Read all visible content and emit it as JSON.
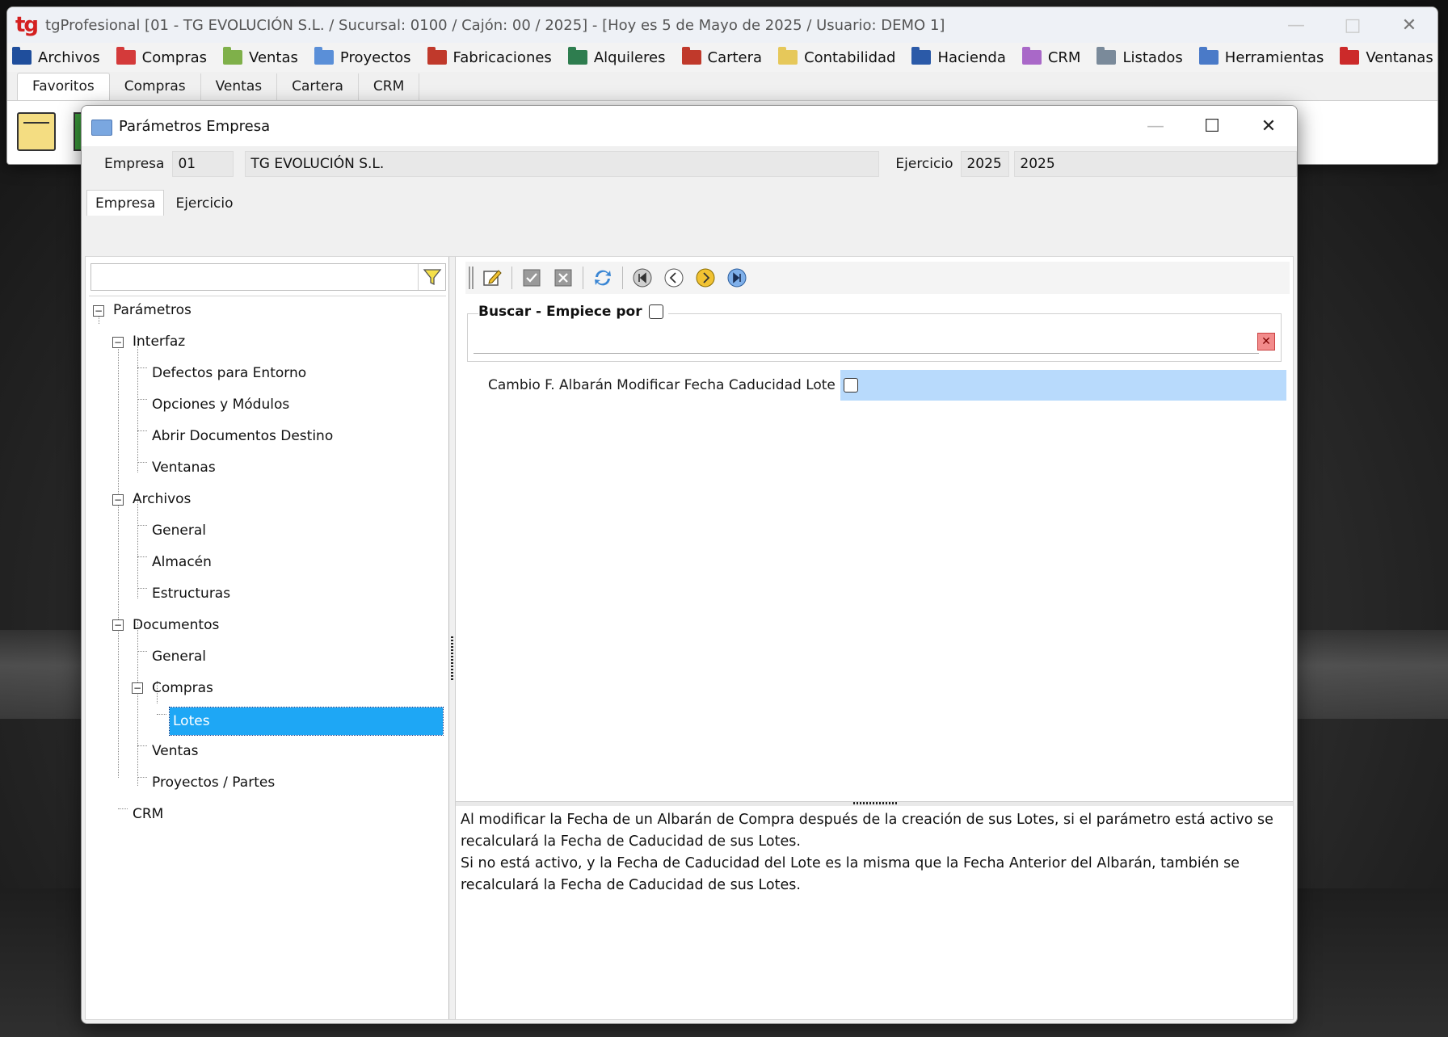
{
  "main_window": {
    "logo": "tg",
    "title": "tgProfesional [01 - TG EVOLUCIÓN S.L. / Sucursal: 0100 / Cajón: 00 / 2025] - [Hoy es 5 de Mayo de 2025 / Usuario: DEMO 1]"
  },
  "menu": [
    {
      "label": "Archivos",
      "color": "#1f4e9c"
    },
    {
      "label": "Compras",
      "color": "#d43a3a"
    },
    {
      "label": "Ventas",
      "color": "#7fb04a"
    },
    {
      "label": "Proyectos",
      "color": "#5a8fd8"
    },
    {
      "label": "Fabricaciones",
      "color": "#c0392b"
    },
    {
      "label": "Alquileres",
      "color": "#2e7d4f"
    },
    {
      "label": "Cartera",
      "color": "#c0392b"
    },
    {
      "label": "Contabilidad",
      "color": "#e6c85a"
    },
    {
      "label": "Hacienda",
      "color": "#2b5aa8"
    },
    {
      "label": "CRM",
      "color": "#a968c8"
    },
    {
      "label": "Listados",
      "color": "#7a8a9a"
    },
    {
      "label": "Herramientas",
      "color": "#4a7ac8"
    },
    {
      "label": "Ventanas",
      "color": "#cc2a2a"
    }
  ],
  "ribbon_tabs": [
    "Favoritos",
    "Compras",
    "Ventas",
    "Cartera",
    "CRM"
  ],
  "dialog": {
    "title": "Parámetros Empresa",
    "empresa_label": "Empresa",
    "empresa_code": "01",
    "empresa_name": "TG EVOLUCIÓN S.L.",
    "ejercicio_label": "Ejercicio",
    "ejercicio_code": "2025",
    "ejercicio_value": "2025",
    "tabs": [
      "Empresa",
      "Ejercicio"
    ]
  },
  "tree": {
    "filter_value": "",
    "nodes": [
      {
        "label": "Parámetros"
      },
      {
        "label": "Interfaz"
      },
      {
        "label": "Defectos para Entorno"
      },
      {
        "label": "Opciones y Módulos"
      },
      {
        "label": "Abrir Documentos Destino"
      },
      {
        "label": "Ventanas"
      },
      {
        "label": "Archivos"
      },
      {
        "label": "General"
      },
      {
        "label": "Almacén"
      },
      {
        "label": "Estructuras"
      },
      {
        "label": "Documentos"
      },
      {
        "label": "General"
      },
      {
        "label": "Compras"
      },
      {
        "label": "Lotes"
      },
      {
        "label": "Ventas"
      },
      {
        "label": "Proyectos / Partes"
      },
      {
        "label": "CRM"
      }
    ]
  },
  "search": {
    "legend": "Buscar - Empiece por",
    "value": ""
  },
  "parameter": {
    "label": "Cambio F. Albarán Modificar Fecha Caducidad Lote"
  },
  "description": {
    "line1": "Al modificar la Fecha de un Albarán de Compra después de la creación de sus Lotes, si el parámetro está activo se recalculará la Fecha de Caducidad de sus Lotes.",
    "line2": "Si no está activo, y la Fecha de Caducidad del Lote es la misma que la Fecha Anterior del Albarán, también se recalculará la Fecha de Caducidad de sus Lotes."
  }
}
